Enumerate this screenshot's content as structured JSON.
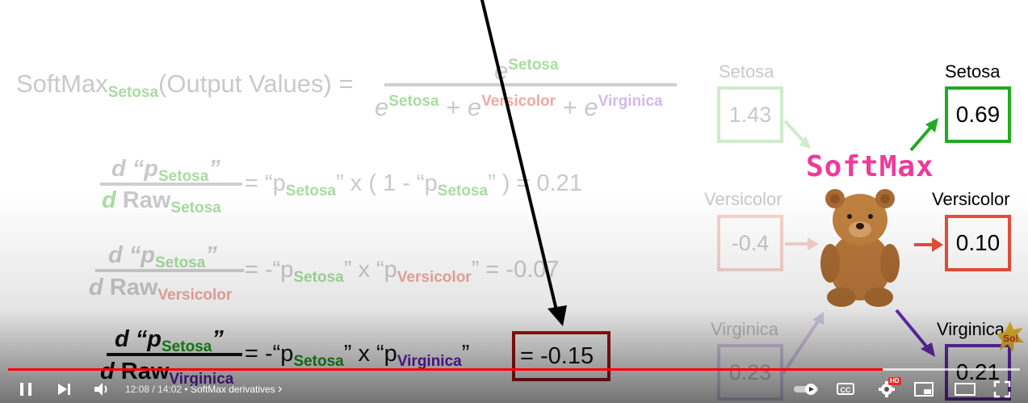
{
  "formula": {
    "lhs_main": "SoftMax",
    "lhs_sub": "Setosa",
    "lhs_args": "(Output Values) =",
    "num_e": "e",
    "num_sup": "Setosa",
    "den_e1": "e",
    "den_sup1": "Setosa",
    "den_plus1": "+",
    "den_e2": "e",
    "den_sup2": "Versicolor",
    "den_plus2": "+",
    "den_e3": "e",
    "den_sup3": "Virginica"
  },
  "derivatives": [
    {
      "num_d": "d “p",
      "num_sub": "Setosa",
      "num_close": "”",
      "den_d": "d",
      "den_raw": "Raw",
      "den_sub": "Setosa",
      "rhs_1": "= “p",
      "rhs_sub1": "Setosa",
      "rhs_2": "” x ( 1 - “p",
      "rhs_sub2": "Setosa",
      "rhs_3": "” ) = 0.21"
    },
    {
      "num_d": "d “p",
      "num_sub": "Setosa",
      "num_close": "”",
      "den_d": "d",
      "den_raw": "Raw",
      "den_sub": "Versicolor",
      "rhs_1": "= -“p",
      "rhs_sub1": "Setosa",
      "rhs_2": "” x “p",
      "rhs_sub2": "Versicolor",
      "rhs_3": "” = -0.07"
    },
    {
      "num_d": "d “p",
      "num_sub": "Setosa",
      "num_close": "”",
      "den_d": "d",
      "den_raw": "Raw",
      "den_sub": "Virginica",
      "rhs_1": "= -“p",
      "rhs_sub1": "Setosa",
      "rhs_2": "” x “p",
      "rhs_sub2": "Virginica",
      "rhs_3": "”",
      "result": "= -0.15"
    }
  ],
  "diagram": {
    "softmax_label": "SoftMax",
    "inputs": [
      {
        "label": "Setosa",
        "value": "1.43"
      },
      {
        "label": "Versicolor",
        "value": "-0.4"
      },
      {
        "label": "Virginica",
        "value": "0.23"
      }
    ],
    "outputs": [
      {
        "label": "Setosa",
        "value": "0.69"
      },
      {
        "label": "Versicolor",
        "value": "0.10"
      },
      {
        "label": "Virginica",
        "value": "0.21"
      }
    ],
    "colors": {
      "setosa": "#22aa22",
      "versicolor": "#e8503a",
      "virginica": "#6b2fbf",
      "softmax": "#ee3a99",
      "result_box": "#a11616"
    }
  },
  "player": {
    "time_display": "12:08 / 14:02",
    "separator": "•",
    "chapter": "SoftMax derivatives",
    "chapter_chevron": "›",
    "progress_fraction": 0.864,
    "buffer_fraction": 1.0,
    "hd_badge": "HD",
    "icons": [
      "pause-icon",
      "next-icon",
      "volume-icon",
      "autoplay-toggle-icon",
      "captions-icon",
      "settings-icon",
      "miniplayer-icon",
      "theater-icon",
      "fullscreen-icon"
    ],
    "captions_label": "CC"
  }
}
